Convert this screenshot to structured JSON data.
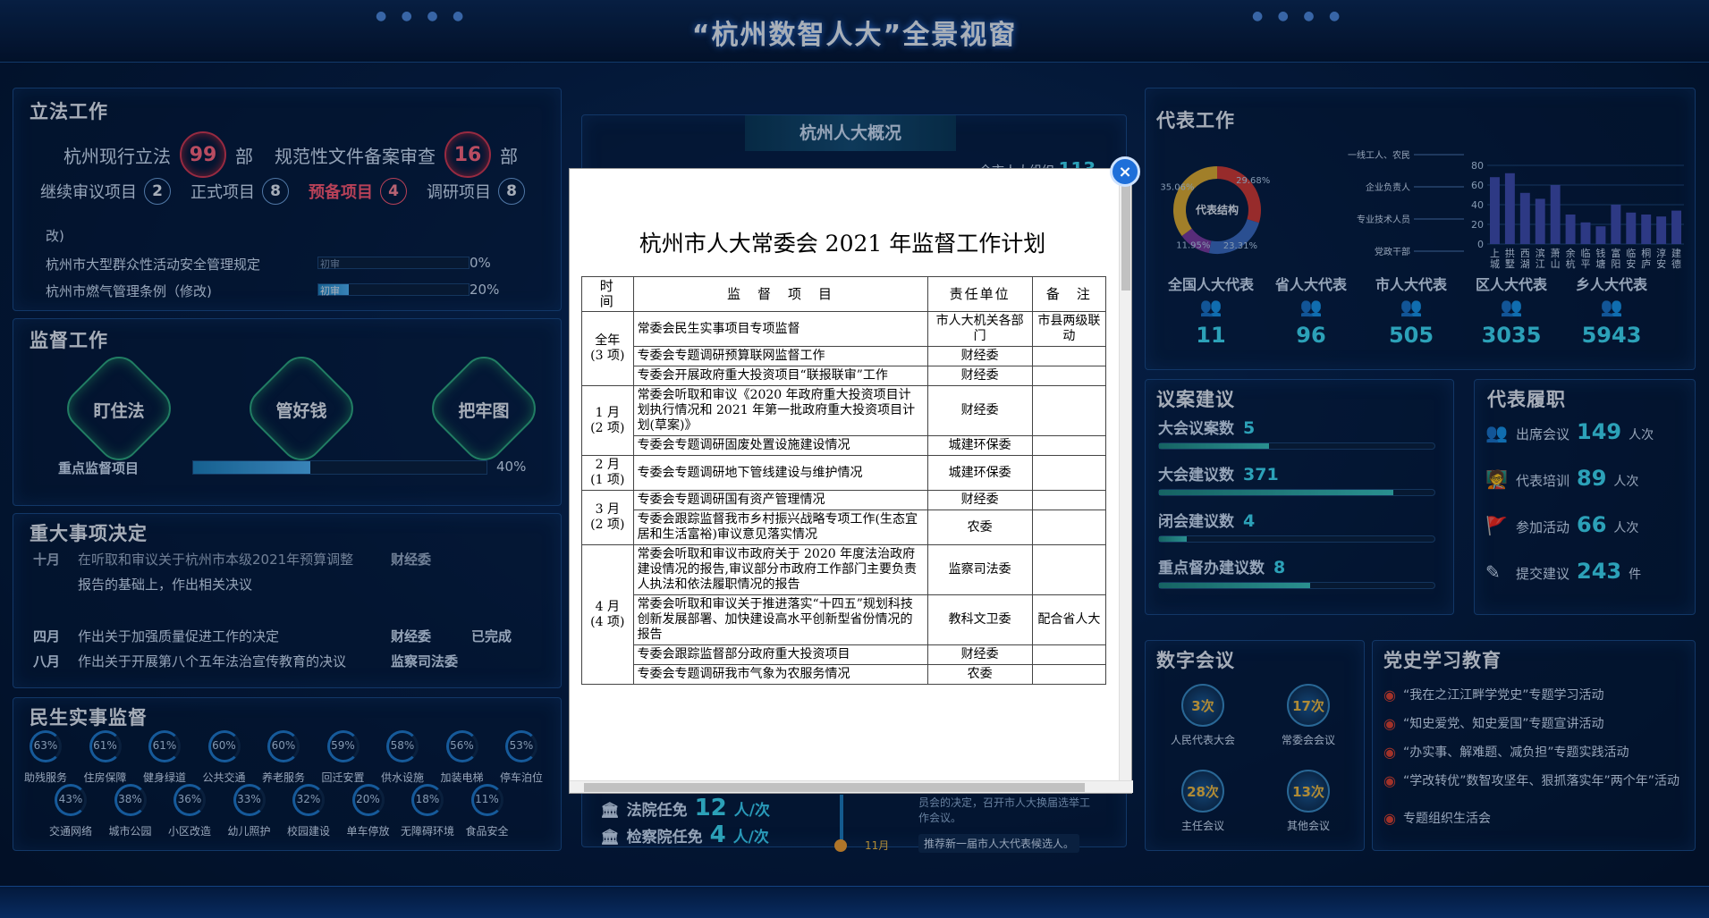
{
  "header": {
    "title": "“杭州数智人大”全景视窗"
  },
  "legislation": {
    "title": "立法工作",
    "current_label": "杭州现行立法",
    "current_value": "99",
    "current_unit": "部",
    "docs_label": "规范性文件备案审查",
    "docs_value": "16",
    "docs_unit": "部",
    "items": [
      {
        "label": "继续审议项目",
        "value": "2"
      },
      {
        "label": "正式项目",
        "value": "8"
      },
      {
        "label": "预备项目",
        "value": "4"
      },
      {
        "label": "调研项目",
        "value": "8"
      }
    ],
    "partial_line": "改)",
    "laws": [
      {
        "name": "杭州市大型群众性活动安全管理规定",
        "stage": "初审",
        "pct": "0%",
        "progress": 0
      },
      {
        "name": "杭州市燃气管理条例（修改)",
        "stage": "初审",
        "pct": "20%",
        "progress": 20
      }
    ]
  },
  "supervision": {
    "title": "监督工作",
    "hexes": [
      "盯住法",
      "管好钱",
      "把牢图"
    ],
    "key_label": "重点监督项目",
    "key_pct": "40%",
    "key_progress": 40
  },
  "decisions": {
    "title": "重大事项决定",
    "rows": [
      {
        "month": "十月",
        "text": "在听取和审议关于杭州市本级2021年预算调整",
        "dept": "财经委",
        "status": ""
      },
      {
        "month": "",
        "text": "报告的基础上，作出相关决议",
        "dept": "",
        "status": ""
      },
      {
        "month": "四月",
        "text": "作出关于加强质量促进工作的决定",
        "dept": "财经委",
        "status": "已完成"
      },
      {
        "month": "八月",
        "text": "作出关于开展第八个五年法治宣传教育的决议",
        "dept": "监察司法委",
        "status": ""
      }
    ]
  },
  "livelihood": {
    "title": "民生实事监督",
    "row1": [
      {
        "pct": "63%",
        "label": "助残服务"
      },
      {
        "pct": "61%",
        "label": "住房保障"
      },
      {
        "pct": "61%",
        "label": "健身绿道"
      },
      {
        "pct": "60%",
        "label": "公共交通"
      },
      {
        "pct": "60%",
        "label": "养老服务"
      },
      {
        "pct": "59%",
        "label": "回迁安置"
      },
      {
        "pct": "58%",
        "label": "供水设施"
      },
      {
        "pct": "56%",
        "label": "加装电梯"
      },
      {
        "pct": "53%",
        "label": "停车泊位"
      }
    ],
    "row2": [
      {
        "pct": "43%",
        "label": "交通网络"
      },
      {
        "pct": "38%",
        "label": "城市公园"
      },
      {
        "pct": "36%",
        "label": "小区改造"
      },
      {
        "pct": "33%",
        "label": "幼儿照护"
      },
      {
        "pct": "32%",
        "label": "校园建设"
      },
      {
        "pct": "20%",
        "label": "单车停放"
      },
      {
        "pct": "18%",
        "label": "无障碍环境"
      },
      {
        "pct": "11%",
        "label": "食品安全"
      }
    ]
  },
  "overview": {
    "title": "杭州人大概况",
    "partial_text": "全市人大组织",
    "partial_num": "113",
    "appoint": [
      {
        "label": "法院任免",
        "value": "12",
        "unit": "人/次"
      },
      {
        "label": "检察院任免",
        "value": "4",
        "unit": "人/次"
      }
    ],
    "timeline_month": "11月",
    "timeline_text": "推荐新一届市人大代表候选人。",
    "timeline_partial": "员会的决定，召开市人大换届选举工作会议。"
  },
  "deputies": {
    "title": "代表工作",
    "donut_center": "代表结构",
    "donut_pcts": [
      "29.68%",
      "23.31%",
      "11.95%",
      "35.06%"
    ],
    "donut_legend": [
      "一线工人、农民",
      "企业负责人",
      "专业技术人员",
      "党政干部"
    ],
    "bar_axis": [
      "80",
      "60",
      "40",
      "20",
      "0"
    ],
    "bar_categories": [
      "上城",
      "拱墅",
      "西湖",
      "滨江",
      "萧山",
      "余杭",
      "临平",
      "钱塘",
      "富阳",
      "临安",
      "桐庐",
      "淳安",
      "建德"
    ],
    "bar_values": [
      68,
      72,
      52,
      46,
      60,
      30,
      22,
      18,
      40,
      32,
      30,
      28,
      34
    ],
    "levels": [
      {
        "label": "全国人大代表",
        "value": "11"
      },
      {
        "label": "省人大代表",
        "value": "96"
      },
      {
        "label": "市人大代表",
        "value": "505"
      },
      {
        "label": "区人大代表",
        "value": "3035"
      },
      {
        "label": "乡人大代表",
        "value": "5943"
      }
    ]
  },
  "proposals": {
    "title": "议案建议",
    "rows": [
      {
        "label": "大会议案数",
        "value": "5"
      },
      {
        "label": "大会建议数",
        "value": "371"
      },
      {
        "label": "闭会建议数",
        "value": "4"
      },
      {
        "label": "重点督办建议数",
        "value": "8"
      }
    ]
  },
  "duties": {
    "title": "代表履职",
    "rows": [
      {
        "label": "出席会议",
        "value": "149",
        "unit": "人次"
      },
      {
        "label": "代表培训",
        "value": "89",
        "unit": "人次"
      },
      {
        "label": "参加活动",
        "value": "66",
        "unit": "人次"
      },
      {
        "label": "提交建议",
        "value": "243",
        "unit": "件"
      }
    ]
  },
  "digital_meetings": {
    "title": "数字会议",
    "items": [
      {
        "count": "3次",
        "label": "人民代表大会"
      },
      {
        "count": "17次",
        "label": "常委会会议"
      },
      {
        "count": "28次",
        "label": "主任会议"
      },
      {
        "count": "13次",
        "label": "其他会议"
      }
    ]
  },
  "party_history": {
    "title": "党史学习教育",
    "items": [
      "“我在之江江畔学党史”专题学习活动",
      "“知史爱党、知史爱国”专题宣讲活动",
      "“办实事、解难题、减负担”专题实践活动",
      "“学改转优”数智攻坚年、狠抓落实年”两个年”活动",
      "专题组织生活会"
    ]
  },
  "modal": {
    "close_label": "×",
    "title": "杭州市人大常委会 2021 年监督工作计划",
    "headers": [
      "时　间",
      "监　督　项　目",
      "责任单位",
      "备　注"
    ],
    "groups": [
      {
        "period": "全年",
        "count": "(3 项)",
        "rows": [
          {
            "item": "常委会民生实事项目专项监督",
            "unit": "市人大机关各部门",
            "note": "市县两级联动"
          },
          {
            "item": "专委会专题调研预算联网监督工作",
            "unit": "财经委",
            "note": ""
          },
          {
            "item": "专委会开展政府重大投资项目“联报联审”工作",
            "unit": "财经委",
            "note": ""
          }
        ]
      },
      {
        "period": "1 月",
        "count": "(2 项)",
        "rows": [
          {
            "item": "常委会听取和审议《2020 年政府重大投资项目计划执行情况和 2021 年第一批政府重大投资项目计划(草案)》",
            "unit": "财经委",
            "note": ""
          },
          {
            "item": "专委会专题调研固废处置设施建设情况",
            "unit": "城建环保委",
            "note": ""
          }
        ]
      },
      {
        "period": "2 月",
        "count": "(1 项)",
        "rows": [
          {
            "item": "专委会专题调研地下管线建设与维护情况",
            "unit": "城建环保委",
            "note": ""
          }
        ]
      },
      {
        "period": "3 月",
        "count": "(2 项)",
        "rows": [
          {
            "item": "专委会专题调研国有资产管理情况",
            "unit": "财经委",
            "note": ""
          },
          {
            "item": "专委会跟踪监督我市乡村振兴战略专项工作(生态宜居和生活富裕)审议意见落实情况",
            "unit": "农委",
            "note": ""
          }
        ]
      },
      {
        "period": "4 月",
        "count": "(4 项)",
        "rows": [
          {
            "item": "常委会听取和审议市政府关于 2020 年度法治政府建设情况的报告,审议部分市政府工作部门主要负责人执法和依法履职情况的报告",
            "unit": "监察司法委",
            "note": ""
          },
          {
            "item": "常委会听取和审议关于推进落实“十四五”规划科技创新发展部署、加快建设高水平创新型省份情况的报告",
            "unit": "教科文卫委",
            "note": "配合省人大"
          },
          {
            "item": "专委会跟踪监督部分政府重大投资项目",
            "unit": "财经委",
            "note": ""
          },
          {
            "item": "专委会专题调研我市气象为农服务情况",
            "unit": "农委",
            "note": ""
          }
        ]
      }
    ]
  }
}
